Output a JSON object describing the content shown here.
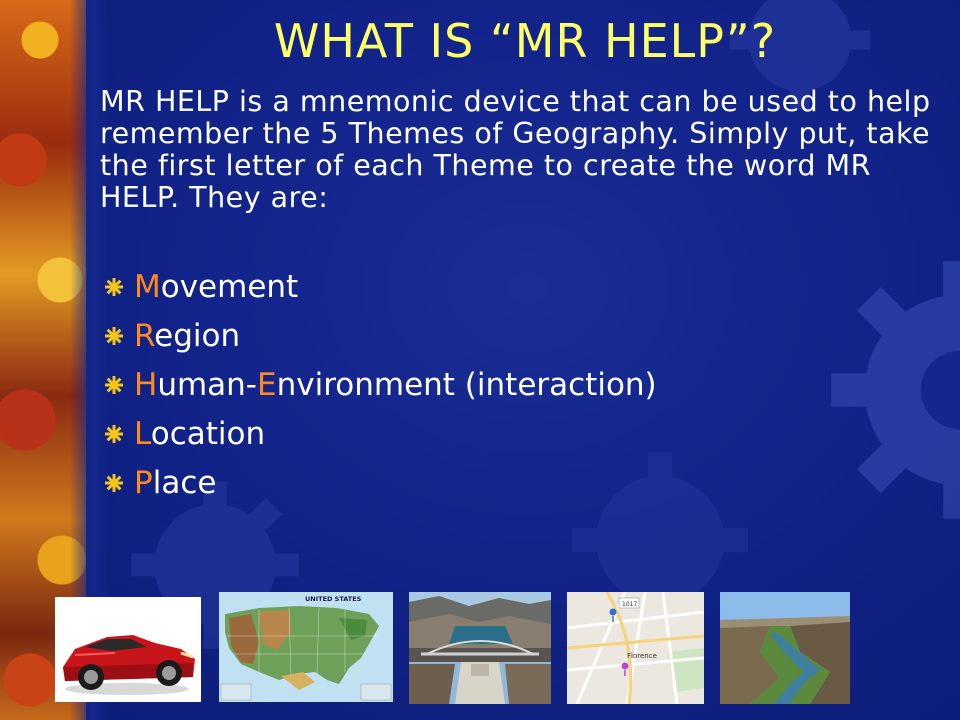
{
  "slide": {
    "title": "WHAT IS “MR HELP”?",
    "intro": "MR HELP is a mnemonic device that can be used to help remember the 5 Themes of Geography.  Simply put, take the first letter of each Theme to create the word MR HELP.  They are:"
  },
  "themes": [
    {
      "segments": [
        {
          "text": "M",
          "hl": true
        },
        {
          "text": "ovement",
          "hl": false
        }
      ]
    },
    {
      "segments": [
        {
          "text": "R",
          "hl": true
        },
        {
          "text": "egion",
          "hl": false
        }
      ]
    },
    {
      "segments": [
        {
          "text": "H",
          "hl": true
        },
        {
          "text": "uman-",
          "hl": false
        },
        {
          "text": "E",
          "hl": true
        },
        {
          "text": "nvironment (interaction)",
          "hl": false
        }
      ]
    },
    {
      "segments": [
        {
          "text": "L",
          "hl": true
        },
        {
          "text": "ocation",
          "hl": false
        }
      ]
    },
    {
      "segments": [
        {
          "text": "P",
          "hl": true
        },
        {
          "text": "lace",
          "hl": false
        }
      ]
    }
  ],
  "images": {
    "car": {
      "icon": "red-sports-car"
    },
    "map": {
      "icon": "usa-relief-map",
      "label": "UNITED STATES"
    },
    "dam": {
      "icon": "dam-bridge-photo"
    },
    "streetmap": {
      "icon": "street-map",
      "road_label": "1017",
      "place_label": "Florence"
    },
    "canyon": {
      "icon": "river-canyon-photo"
    }
  },
  "colors": {
    "background": "#12238a",
    "title": "#ffff66",
    "body_text": "#ffffff",
    "highlight": "#ff8a1a",
    "bullet": "#f5c518"
  }
}
